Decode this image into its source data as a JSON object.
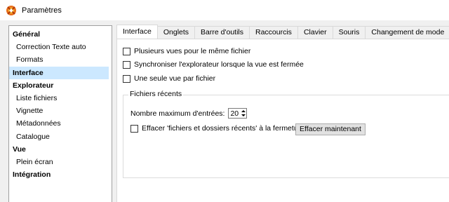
{
  "window": {
    "title": "Paramètres",
    "icon": "xnview-app-icon"
  },
  "sidebar": {
    "items": [
      {
        "label": "Général",
        "level": 0,
        "selected": false
      },
      {
        "label": "Correction Texte auto",
        "level": 1,
        "selected": false
      },
      {
        "label": "Formats",
        "level": 1,
        "selected": false
      },
      {
        "label": "Interface",
        "level": 0,
        "selected": true
      },
      {
        "label": "Explorateur",
        "level": 0,
        "selected": false
      },
      {
        "label": "Liste fichiers",
        "level": 1,
        "selected": false
      },
      {
        "label": "Vignette",
        "level": 1,
        "selected": false
      },
      {
        "label": "Métadonnées",
        "level": 1,
        "selected": false
      },
      {
        "label": "Catalogue",
        "level": 1,
        "selected": false
      },
      {
        "label": "Vue",
        "level": 0,
        "selected": false
      },
      {
        "label": "Plein écran",
        "level": 1,
        "selected": false
      },
      {
        "label": "Intégration",
        "level": 0,
        "selected": false
      }
    ]
  },
  "tabs": [
    {
      "label": "Interface",
      "active": true
    },
    {
      "label": "Onglets",
      "active": false
    },
    {
      "label": "Barre d'outils",
      "active": false
    },
    {
      "label": "Raccourcis",
      "active": false
    },
    {
      "label": "Clavier",
      "active": false
    },
    {
      "label": "Souris",
      "active": false
    },
    {
      "label": "Changement de mode",
      "active": false
    }
  ],
  "options": {
    "multiple_views": {
      "label": "Plusieurs vues pour le même fichier",
      "checked": false
    },
    "sync_explorer": {
      "label": "Synchroniser l'explorateur lorsque la vue est fermée",
      "checked": false
    },
    "single_view": {
      "label": "Une seule vue par fichier",
      "checked": false
    }
  },
  "recent_files": {
    "group_title": "Fichiers récents",
    "max_entries_label": "Nombre maximum d'entrées:",
    "max_entries_value": "20",
    "clear_on_close_label": "Effacer 'fichiers et dossiers récents' à la fermeture",
    "clear_on_close_checked": false,
    "clear_now_button": "Effacer maintenant"
  },
  "colors": {
    "selection": "#cce8ff",
    "panel_bg": "#ffffff",
    "window_bg": "#f0f0f0"
  }
}
